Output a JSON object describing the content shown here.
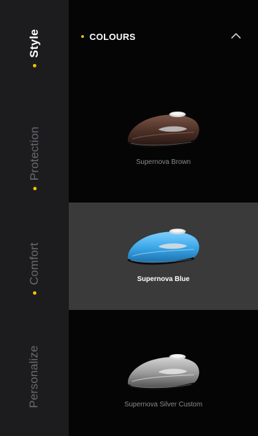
{
  "sidebar": {
    "items": [
      {
        "label": "Style",
        "active": true
      },
      {
        "label": "Protection",
        "active": false
      },
      {
        "label": "Comfort",
        "active": false
      },
      {
        "label": "Personalize",
        "active": false
      }
    ]
  },
  "section": {
    "title": "COLOURS",
    "collapse_icon": "chevron-up-icon"
  },
  "colours": [
    {
      "label": "Supernova Brown",
      "color": "#5a3a2e",
      "selected": false
    },
    {
      "label": "Supernova Blue",
      "color": "#3aa6e8",
      "selected": true
    },
    {
      "label": "Supernova Silver Custom",
      "color": "#9a9a9a",
      "selected": false
    }
  ],
  "theme": {
    "accent": "#f2c200",
    "sidebar_bg": "#1c1c1f",
    "selected_bg": "#3a3a3a"
  }
}
